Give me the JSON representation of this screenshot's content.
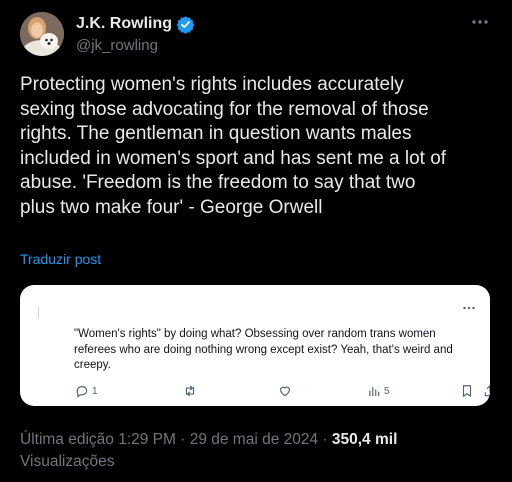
{
  "author": {
    "display_name": "J.K. Rowling",
    "handle": "@jk_rowling",
    "verified_color": "#1d9bf0",
    "avatar_icon": "profile-photo"
  },
  "tweet": {
    "text": "Protecting women's rights includes accurately\nsexing those advocating for the removal of those\nrights. The gentleman in question wants males\nincluded in women's sport and has sent me a lot of\nabuse. 'Freedom is the freedom to say that two\nplus two make four' - George Orwell",
    "translate_label": "Traduzir post"
  },
  "quoted_post": {
    "text": "\"Women's rights\" by doing what? Obsessing over random trans women referees who are doing nothing wrong except exist? Yeah, that's weird and creepy.",
    "reply_count": "1",
    "view_count": "5"
  },
  "meta": {
    "edited_label": "Última edição 1:29 PM · 29 de mai de 2024 · ",
    "views_count": "350,4 mil",
    "views_label": "Visualizações"
  },
  "colors": {
    "background": "#000000",
    "text": "#e7e9ea",
    "secondary": "#71767b",
    "link": "#1d9bf0"
  }
}
